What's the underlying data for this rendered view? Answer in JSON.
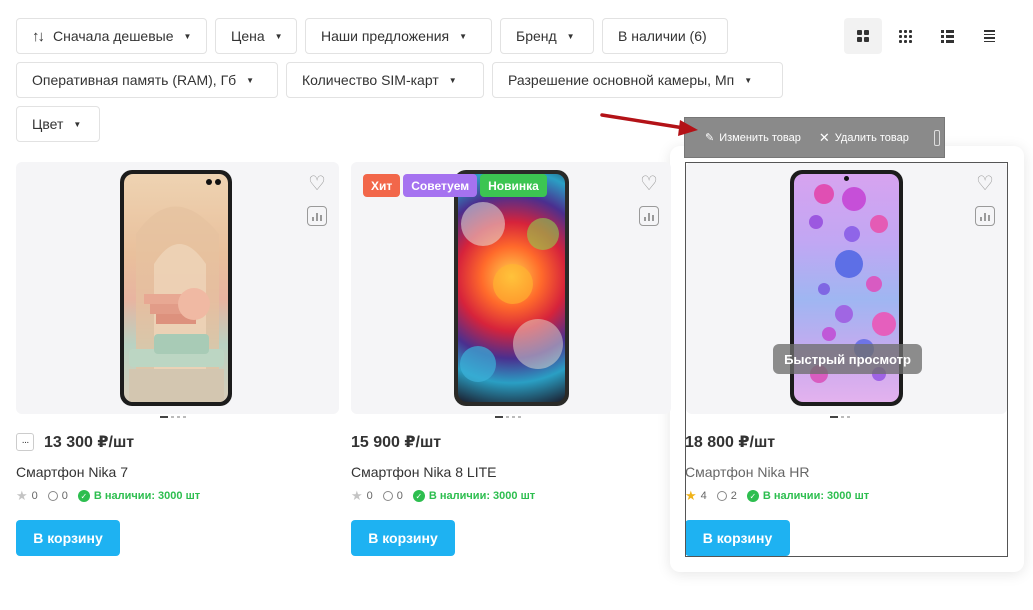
{
  "filters": {
    "sort": "Сначала дешевые",
    "price": "Цена",
    "offers": "Наши предложения",
    "brand": "Бренд",
    "in_stock": "В наличии (6)",
    "ram": "Оперативная память (RAM), Гб",
    "sim": "Количество SIM-карт",
    "camera": "Разрешение основной камеры, Мп",
    "color": "Цвет"
  },
  "view_modes": [
    "grid-large",
    "grid-small",
    "list",
    "table"
  ],
  "admin_bar": {
    "edit_label": "Изменить товар",
    "delete_label": "Удалить товар"
  },
  "products": [
    {
      "price": "13 300 ₽/шт",
      "name": "Смартфон Nika 7",
      "rating": "0",
      "reviews": "0",
      "stock": "В наличии: 3000 шт",
      "cart_label": "В корзину"
    },
    {
      "price": "15 900 ₽/шт",
      "name": "Смартфон Nika 8 LITE",
      "rating": "0",
      "reviews": "0",
      "stock": "В наличии: 3000 шт",
      "cart_label": "В корзину",
      "badges": [
        "Хит",
        "Советуем",
        "Новинка"
      ]
    },
    {
      "price": "18 800 ₽/шт",
      "name": "Смартфон Nika HR",
      "rating": "4",
      "reviews": "2",
      "stock": "В наличии: 3000 шт",
      "cart_label": "В корзину",
      "quick_view": "Быстрый просмотр"
    }
  ],
  "colors": {
    "accent": "#1eb2f2",
    "stock_green": "#2dbe4f",
    "badge_hit": "#f2674a",
    "badge_recommend": "#a572f0",
    "badge_new": "#3cc552",
    "annotation_arrow": "#b31217"
  }
}
